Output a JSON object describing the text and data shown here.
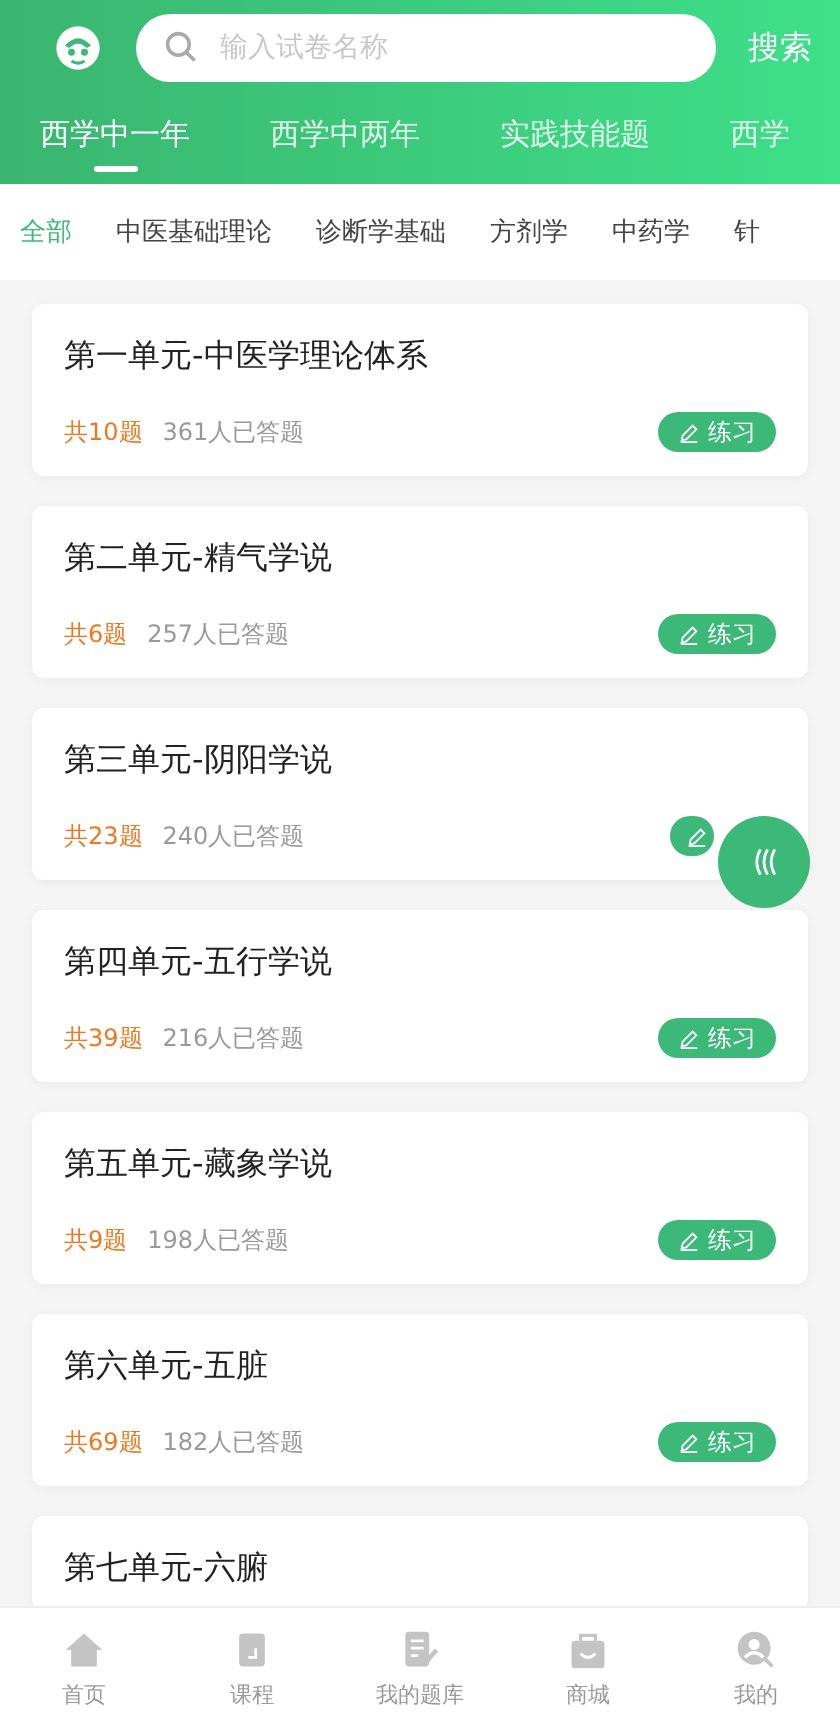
{
  "search": {
    "placeholder": "输入试卷名称",
    "button": "搜索"
  },
  "tabs": [
    {
      "label": "西学中一年",
      "selected": true
    },
    {
      "label": "西学中两年",
      "selected": false
    },
    {
      "label": "实践技能题",
      "selected": false
    },
    {
      "label": "西学",
      "selected": false
    }
  ],
  "categories": [
    {
      "label": "全部",
      "selected": true
    },
    {
      "label": "中医基础理论",
      "selected": false
    },
    {
      "label": "诊断学基础",
      "selected": false
    },
    {
      "label": "方剂学",
      "selected": false
    },
    {
      "label": "中药学",
      "selected": false
    },
    {
      "label": "针",
      "selected": false
    }
  ],
  "units": [
    {
      "title": "第一单元-中医学理论体系",
      "count": "共10题",
      "answered": "361人已答题",
      "action": "练习"
    },
    {
      "title": "第二单元-精气学说",
      "count": "共6题",
      "answered": "257人已答题",
      "action": "练习"
    },
    {
      "title": "第三单元-阴阳学说",
      "count": "共23题",
      "answered": "240人已答题"
    },
    {
      "title": "第四单元-五行学说",
      "count": "共39题",
      "answered": "216人已答题",
      "action": "练习"
    },
    {
      "title": "第五单元-藏象学说",
      "count": "共9题",
      "answered": "198人已答题",
      "action": "练习"
    },
    {
      "title": "第六单元-五脏",
      "count": "共69题",
      "answered": "182人已答题",
      "action": "练习"
    },
    {
      "title": "第七单元-六腑"
    }
  ],
  "nav": [
    {
      "label": "首页"
    },
    {
      "label": "课程"
    },
    {
      "label": "我的题库"
    },
    {
      "label": "商城"
    },
    {
      "label": "我的"
    }
  ]
}
